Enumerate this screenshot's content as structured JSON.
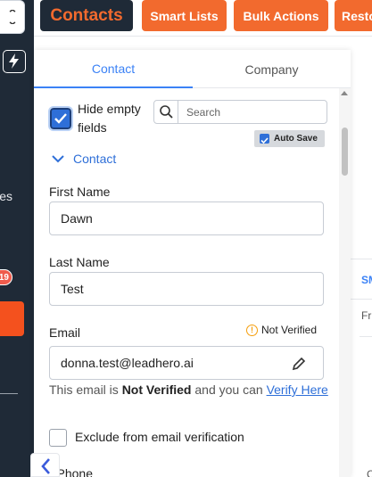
{
  "topbar": {
    "contacts_label": "Contacts",
    "smart_lists_label": "Smart Lists",
    "bulk_actions_label": "Bulk Actions",
    "restore_label": "Resto"
  },
  "sidebar": {
    "partial_text": "es",
    "badge_count": "19"
  },
  "panel": {
    "tabs": [
      {
        "label": "Contact",
        "active": true
      },
      {
        "label": "Company",
        "active": false
      }
    ],
    "hide_empty_label": "Hide empty fields",
    "hide_empty_checked": true,
    "search_placeholder": "Search",
    "auto_save_label": "Auto Save",
    "auto_save_checked": true,
    "section_title": "Contact",
    "first_name_label": "First Name",
    "first_name_value": "Dawn",
    "last_name_label": "Last Name",
    "last_name_value": "Test",
    "email_label": "Email",
    "email_status": "Not Verified",
    "email_value": "donna.test@leadhero.ai",
    "email_note_prefix": "This email is",
    "email_note_bold": "Not Verified",
    "email_note_mid": "and you can",
    "email_note_link": "Verify Here",
    "exclude_label": "Exclude from email verification",
    "phone_label": "Phone"
  },
  "background": {
    "tab_text": "SM",
    "row_text": "Fr",
    "bottom_text": "C"
  },
  "colors": {
    "accent_orange": "#f26a2e",
    "dark_navy": "#1f2a37",
    "primary_blue": "#2e6fd8",
    "warning_amber": "#f59e0b"
  }
}
